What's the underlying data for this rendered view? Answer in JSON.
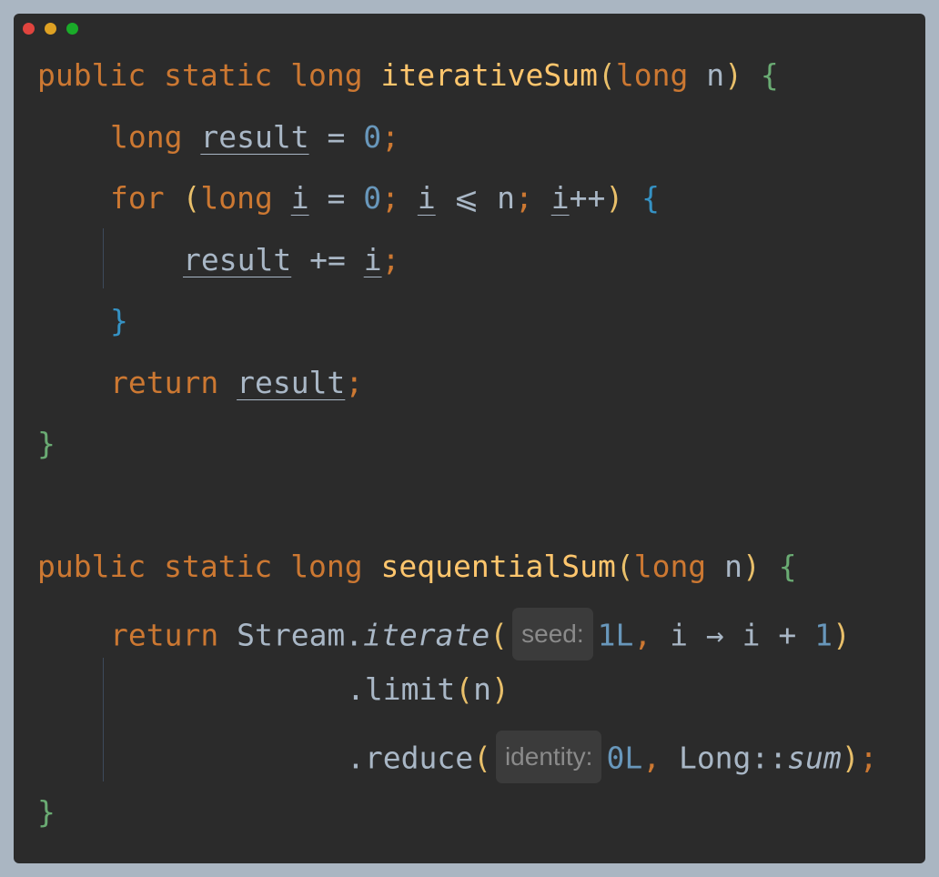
{
  "window": {
    "controls": [
      "close",
      "minimize",
      "zoom"
    ]
  },
  "code": {
    "m1": {
      "kw1": "public",
      "kw2": "static",
      "kw3": "long",
      "name": "iterativeSum",
      "lp": "(",
      "ptype": "long",
      "pname": "n",
      "rp": ")",
      "brace": "{"
    },
    "l2": {
      "kw": "long",
      "var": "result",
      "op": " = ",
      "num": "0",
      "semi": ";"
    },
    "l3": {
      "kw": "for",
      "lp": "(",
      "kw2": "long",
      "var1": "i",
      "op1": " = ",
      "num": "0",
      "semi1": ";",
      "var2": "i",
      "op2": " ⩽ ",
      "n": "n",
      "semi2": ";",
      "var3": "i",
      "inc": "++",
      "rp": ")",
      "brace": "{"
    },
    "l4": {
      "var1": "result",
      "op": " += ",
      "var2": "i",
      "semi": ";"
    },
    "l5": {
      "brace": "}"
    },
    "l6": {
      "kw": "return",
      "var": "result",
      "semi": ";"
    },
    "l7": {
      "brace": "}"
    },
    "m2": {
      "kw1": "public",
      "kw2": "static",
      "kw3": "long",
      "name": "sequentialSum",
      "lp": "(",
      "ptype": "long",
      "pname": "n",
      "rp": ")",
      "brace": "{"
    },
    "l9": {
      "kw": "return",
      "cls": "Stream.",
      "method": "iterate",
      "lp": "(",
      "hint": "seed:",
      "num1": "1L",
      "comma": ",",
      "lambda": " i → i + ",
      "num2": "1",
      "rp": ")"
    },
    "l10": {
      "dot": ".limit",
      "lp": "(",
      "arg": "n",
      "rp": ")"
    },
    "l11": {
      "dot": ".reduce",
      "lp": "(",
      "hint": "identity:",
      "num": "0L",
      "comma": ",",
      "ref": " Long::",
      "method": "sum",
      "rp": ")",
      "semi": ";"
    },
    "l12": {
      "brace": "}"
    }
  }
}
